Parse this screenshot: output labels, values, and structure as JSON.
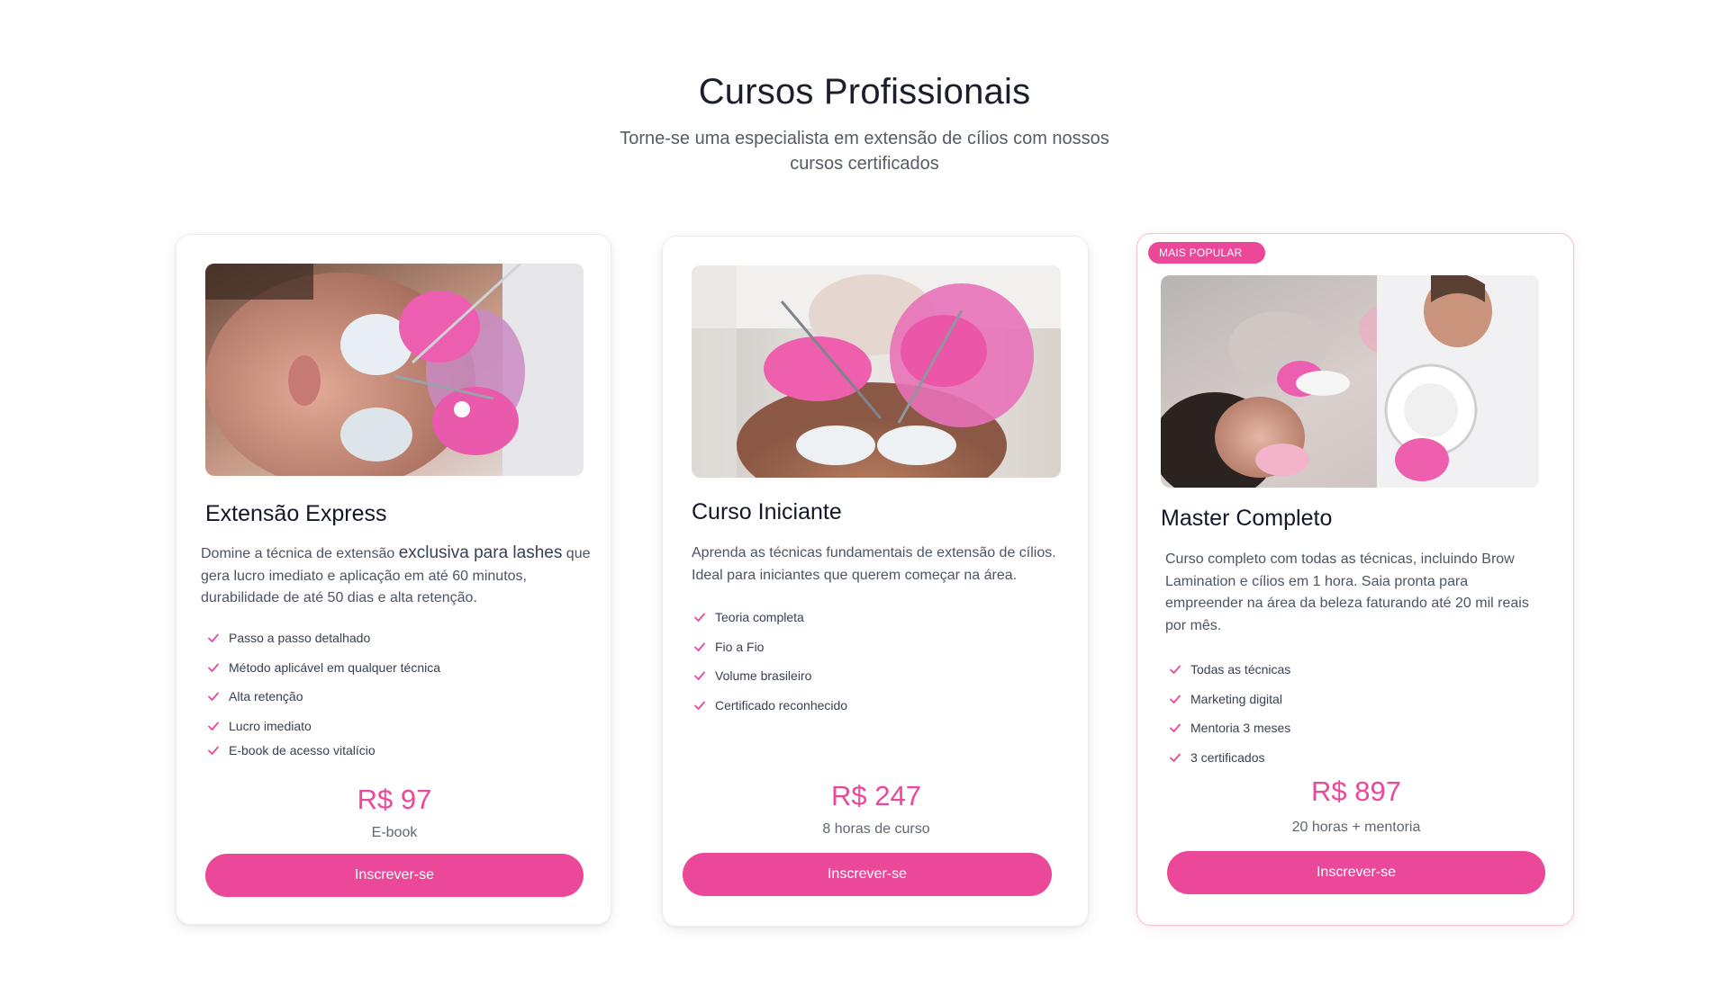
{
  "header": {
    "title": "Cursos Profissionais",
    "subtitle": "Torne-se uma especialista em extensão de cílios com nossos cursos certificados"
  },
  "colors": {
    "accent": "#ec4899",
    "text": "#1f2933",
    "muted": "#4b5563"
  },
  "courses": [
    {
      "title": "Extensão Express",
      "description_start": "Domine a técnica de extensão ",
      "description_accent": "exclusiva para lashes",
      "description_end": " que gera lucro imediato e aplicação em até 60 minutos, durabilidade de até 50 dias e alta retenção.",
      "features": [
        "Passo a passo detalhado",
        "Método aplicável em qualquer técnica",
        "Alta retenção",
        "Lucro imediato",
        "E-book de acesso vitalício"
      ],
      "price": "R$ 97",
      "price_note": "E-book",
      "cta": "Inscrever-se",
      "image_icon": "lash-extension-photo"
    },
    {
      "title": "Curso Iniciante",
      "description": "Aprenda as técnicas fundamentais de extensão de cílios. Ideal para iniciantes que querem começar na área.",
      "features": [
        "Teoria completa",
        "Fio a Fio",
        "Volume brasileiro",
        "Certificado reconhecido"
      ],
      "price": "R$ 247",
      "price_note": "8 horas de curso",
      "cta": "Inscrever-se",
      "image_icon": "lash-procedure-photo"
    },
    {
      "badge": "Mais Popular",
      "title": "Master Completo",
      "description": "Curso completo com todas as técnicas, incluindo Brow Lamination e cílios em 1 hora. Saia pronta para empreender na área da beleza faturando até 20 mil reais por mês.",
      "features": [
        "Todas as técnicas",
        "Marketing digital",
        "Mentoria 3 meses",
        "3 certificados"
      ],
      "price": "R$ 897",
      "price_note": "20 horas + mentoria",
      "cta": "Inscrever-se",
      "image_icon": "brow-lamination-photo"
    }
  ]
}
